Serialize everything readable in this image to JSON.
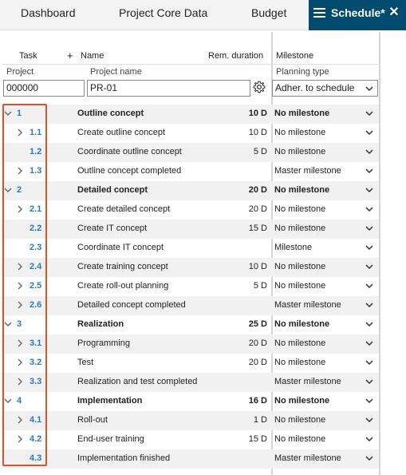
{
  "tabs": [
    {
      "label": "Dashboard",
      "active": false
    },
    {
      "label": "Project Core Data",
      "active": false
    },
    {
      "label": "Budget",
      "active": false
    },
    {
      "label": "Schedule*",
      "active": true
    }
  ],
  "close_glyph": "✕",
  "columns": {
    "task": "Task",
    "add": "+",
    "name": "Name",
    "rem_duration": "Rem. duration",
    "milestone": "Milestone"
  },
  "filters": {
    "project_label": "Project",
    "project_name_label": "Project name",
    "planning_type_label": "Planning type",
    "project_value": "000000",
    "project_name_value": "PR-01",
    "planning_type_value": "Adher. to schedule"
  },
  "rows": [
    {
      "id": "1",
      "level": 0,
      "expander": "down",
      "name": "Outline concept",
      "duration": "10 D",
      "milestone": "No milestone",
      "bold": true
    },
    {
      "id": "1.1",
      "level": 1,
      "expander": "right",
      "name": "Create outline concept",
      "duration": "10 D",
      "milestone": "No milestone",
      "bold": false
    },
    {
      "id": "1.2",
      "level": 1,
      "expander": "",
      "name": "Coordinate outline concept",
      "duration": "5 D",
      "milestone": "No milestone",
      "bold": false
    },
    {
      "id": "1.3",
      "level": 1,
      "expander": "right",
      "name": "Outline concept completed",
      "duration": "",
      "milestone": "Master milestone",
      "bold": false
    },
    {
      "id": "2",
      "level": 0,
      "expander": "down",
      "name": "Detailed concept",
      "duration": "20 D",
      "milestone": "No milestone",
      "bold": true
    },
    {
      "id": "2.1",
      "level": 1,
      "expander": "right",
      "name": "Create detailed concept",
      "duration": "20 D",
      "milestone": "No milestone",
      "bold": false
    },
    {
      "id": "2.2",
      "level": 1,
      "expander": "",
      "name": "Create IT concept",
      "duration": "15 D",
      "milestone": "No milestone",
      "bold": false
    },
    {
      "id": "2.3",
      "level": 1,
      "expander": "",
      "name": "Coordinate IT concept",
      "duration": "",
      "milestone": "Milestone",
      "bold": false
    },
    {
      "id": "2.4",
      "level": 1,
      "expander": "right",
      "name": "Create training concept",
      "duration": "10 D",
      "milestone": "No milestone",
      "bold": false
    },
    {
      "id": "2.5",
      "level": 1,
      "expander": "right",
      "name": "Create roll-out planning",
      "duration": "5 D",
      "milestone": "No milestone",
      "bold": false
    },
    {
      "id": "2.6",
      "level": 1,
      "expander": "right",
      "name": "Detailed concept completed",
      "duration": "",
      "milestone": "Master milestone",
      "bold": false
    },
    {
      "id": "3",
      "level": 0,
      "expander": "down",
      "name": "Realization",
      "duration": "25 D",
      "milestone": "No milestone",
      "bold": true
    },
    {
      "id": "3.1",
      "level": 1,
      "expander": "right",
      "name": "Programming",
      "duration": "20 D",
      "milestone": "No milestone",
      "bold": false
    },
    {
      "id": "3.2",
      "level": 1,
      "expander": "right",
      "name": "Test",
      "duration": "20 D",
      "milestone": "No milestone",
      "bold": false
    },
    {
      "id": "3.3",
      "level": 1,
      "expander": "right",
      "name": "Realization and test completed",
      "duration": "",
      "milestone": "Master milestone",
      "bold": false
    },
    {
      "id": "4",
      "level": 0,
      "expander": "down",
      "name": "Implementation",
      "duration": "16 D",
      "milestone": "No milestone",
      "bold": true
    },
    {
      "id": "4.1",
      "level": 1,
      "expander": "right",
      "name": "Roll-out",
      "duration": "1 D",
      "milestone": "No milestone",
      "bold": false
    },
    {
      "id": "4.2",
      "level": 1,
      "expander": "right",
      "name": "End-user training",
      "duration": "15 D",
      "milestone": "No milestone",
      "bold": false
    },
    {
      "id": "4.3",
      "level": 1,
      "expander": "",
      "name": "Implementation finished",
      "duration": "",
      "milestone": "Master milestone",
      "bold": false
    }
  ],
  "colors": {
    "active_tab": "#004b6e",
    "task_number": "#2b7cb4",
    "highlight_box": "#d9532c",
    "column_separator": "#d9d0e6"
  }
}
